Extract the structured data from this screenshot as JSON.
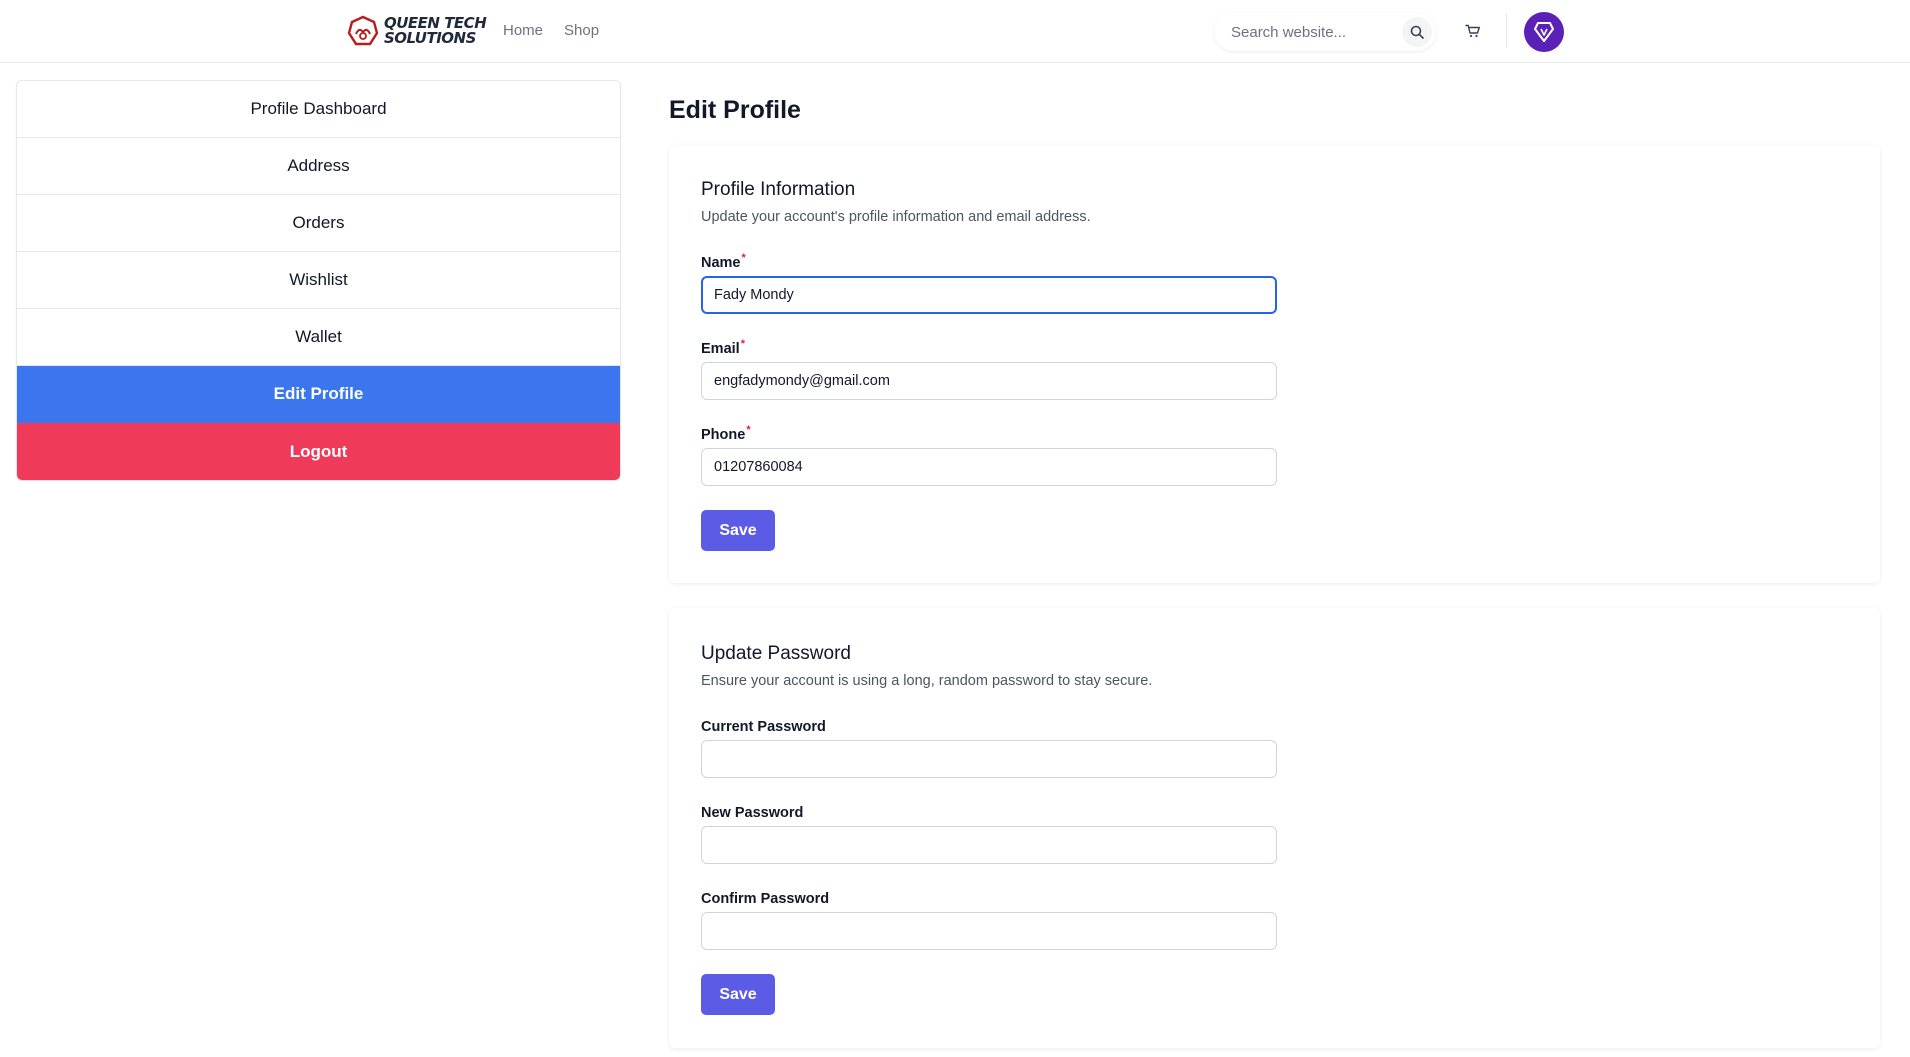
{
  "header": {
    "logo_line1": "QUEEN TECH",
    "logo_line2": "SOLUTIONS",
    "nav": [
      {
        "label": "Home"
      },
      {
        "label": "Shop"
      }
    ],
    "search_placeholder": "Search website...",
    "icons": {
      "search": "search-icon",
      "cart": "cart-icon",
      "avatar": "diamond-icon"
    },
    "avatar_color": "#5b21b6"
  },
  "sidebar": {
    "items": [
      {
        "label": "Profile Dashboard"
      },
      {
        "label": "Address"
      },
      {
        "label": "Orders"
      },
      {
        "label": "Wishlist"
      },
      {
        "label": "Wallet"
      },
      {
        "label": "Edit Profile"
      },
      {
        "label": "Logout"
      }
    ],
    "active": "Edit Profile",
    "active_color": "#3b76ef",
    "logout_color": "#f03a5a"
  },
  "main": {
    "title": "Edit Profile",
    "profile": {
      "title": "Profile Information",
      "description": "Update your account's profile information and email address.",
      "name_label": "Name",
      "name_value": "Fady Mondy",
      "email_label": "Email",
      "email_value": "engfadymondy@gmail.com",
      "phone_label": "Phone",
      "phone_value": "01207860084",
      "required_mark": "*",
      "save_label": "Save"
    },
    "password": {
      "title": "Update Password",
      "description": "Ensure your account is using a long, random password to stay secure.",
      "current_label": "Current Password",
      "current_value": "",
      "new_label": "New Password",
      "new_value": "",
      "confirm_label": "Confirm Password",
      "confirm_value": "",
      "save_label": "Save"
    },
    "button_color": "#5b5be6"
  }
}
